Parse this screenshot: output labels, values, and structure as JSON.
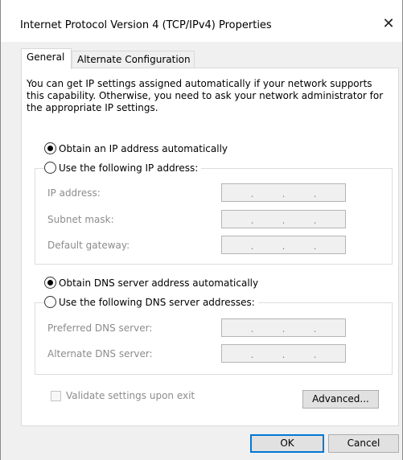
{
  "window": {
    "title": "Internet Protocol Version 4 (TCP/IPv4) Properties",
    "close_glyph": "✕"
  },
  "tabs": [
    {
      "label": "General",
      "selected": true
    },
    {
      "label": "Alternate Configuration",
      "selected": false
    }
  ],
  "description": "You can get IP settings assigned automatically if your network supports this capability. Otherwise, you need to ask your network administrator for the appropriate IP settings.",
  "ip": {
    "auto_label": "Obtain an IP address automatically",
    "manual_label": "Use the following IP address:",
    "selected": "auto",
    "fields": [
      {
        "label": "IP address:",
        "value": ". . ."
      },
      {
        "label": "Subnet mask:",
        "value": ". . ."
      },
      {
        "label": "Default gateway:",
        "value": ". . ."
      }
    ]
  },
  "dns": {
    "auto_label": "Obtain DNS server address automatically",
    "manual_label": "Use the following DNS server addresses:",
    "selected": "auto",
    "fields": [
      {
        "label": "Preferred DNS server:",
        "value": ". . ."
      },
      {
        "label": "Alternate DNS server:",
        "value": ". . ."
      }
    ]
  },
  "validate_label": "Validate settings upon exit",
  "validate_checked": false,
  "buttons": {
    "advanced": "Advanced...",
    "ok": "OK",
    "cancel": "Cancel"
  },
  "colors": {
    "disabled_text": "#8c8c8c",
    "focus_border": "#0078d7"
  }
}
